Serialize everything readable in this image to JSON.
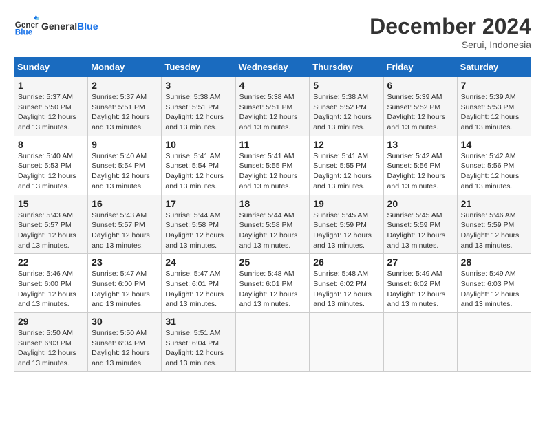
{
  "header": {
    "logo_text_general": "General",
    "logo_text_blue": "Blue",
    "month_title": "December 2024",
    "location": "Serui, Indonesia"
  },
  "days_of_week": [
    "Sunday",
    "Monday",
    "Tuesday",
    "Wednesday",
    "Thursday",
    "Friday",
    "Saturday"
  ],
  "weeks": [
    [
      {
        "day": "1",
        "sunrise": "5:37 AM",
        "sunset": "5:50 PM",
        "daylight": "12 hours and 13 minutes."
      },
      {
        "day": "2",
        "sunrise": "5:37 AM",
        "sunset": "5:51 PM",
        "daylight": "12 hours and 13 minutes."
      },
      {
        "day": "3",
        "sunrise": "5:38 AM",
        "sunset": "5:51 PM",
        "daylight": "12 hours and 13 minutes."
      },
      {
        "day": "4",
        "sunrise": "5:38 AM",
        "sunset": "5:51 PM",
        "daylight": "12 hours and 13 minutes."
      },
      {
        "day": "5",
        "sunrise": "5:38 AM",
        "sunset": "5:52 PM",
        "daylight": "12 hours and 13 minutes."
      },
      {
        "day": "6",
        "sunrise": "5:39 AM",
        "sunset": "5:52 PM",
        "daylight": "12 hours and 13 minutes."
      },
      {
        "day": "7",
        "sunrise": "5:39 AM",
        "sunset": "5:53 PM",
        "daylight": "12 hours and 13 minutes."
      }
    ],
    [
      {
        "day": "8",
        "sunrise": "5:40 AM",
        "sunset": "5:53 PM",
        "daylight": "12 hours and 13 minutes."
      },
      {
        "day": "9",
        "sunrise": "5:40 AM",
        "sunset": "5:54 PM",
        "daylight": "12 hours and 13 minutes."
      },
      {
        "day": "10",
        "sunrise": "5:41 AM",
        "sunset": "5:54 PM",
        "daylight": "12 hours and 13 minutes."
      },
      {
        "day": "11",
        "sunrise": "5:41 AM",
        "sunset": "5:55 PM",
        "daylight": "12 hours and 13 minutes."
      },
      {
        "day": "12",
        "sunrise": "5:41 AM",
        "sunset": "5:55 PM",
        "daylight": "12 hours and 13 minutes."
      },
      {
        "day": "13",
        "sunrise": "5:42 AM",
        "sunset": "5:56 PM",
        "daylight": "12 hours and 13 minutes."
      },
      {
        "day": "14",
        "sunrise": "5:42 AM",
        "sunset": "5:56 PM",
        "daylight": "12 hours and 13 minutes."
      }
    ],
    [
      {
        "day": "15",
        "sunrise": "5:43 AM",
        "sunset": "5:57 PM",
        "daylight": "12 hours and 13 minutes."
      },
      {
        "day": "16",
        "sunrise": "5:43 AM",
        "sunset": "5:57 PM",
        "daylight": "12 hours and 13 minutes."
      },
      {
        "day": "17",
        "sunrise": "5:44 AM",
        "sunset": "5:58 PM",
        "daylight": "12 hours and 13 minutes."
      },
      {
        "day": "18",
        "sunrise": "5:44 AM",
        "sunset": "5:58 PM",
        "daylight": "12 hours and 13 minutes."
      },
      {
        "day": "19",
        "sunrise": "5:45 AM",
        "sunset": "5:59 PM",
        "daylight": "12 hours and 13 minutes."
      },
      {
        "day": "20",
        "sunrise": "5:45 AM",
        "sunset": "5:59 PM",
        "daylight": "12 hours and 13 minutes."
      },
      {
        "day": "21",
        "sunrise": "5:46 AM",
        "sunset": "5:59 PM",
        "daylight": "12 hours and 13 minutes."
      }
    ],
    [
      {
        "day": "22",
        "sunrise": "5:46 AM",
        "sunset": "6:00 PM",
        "daylight": "12 hours and 13 minutes."
      },
      {
        "day": "23",
        "sunrise": "5:47 AM",
        "sunset": "6:00 PM",
        "daylight": "12 hours and 13 minutes."
      },
      {
        "day": "24",
        "sunrise": "5:47 AM",
        "sunset": "6:01 PM",
        "daylight": "12 hours and 13 minutes."
      },
      {
        "day": "25",
        "sunrise": "5:48 AM",
        "sunset": "6:01 PM",
        "daylight": "12 hours and 13 minutes."
      },
      {
        "day": "26",
        "sunrise": "5:48 AM",
        "sunset": "6:02 PM",
        "daylight": "12 hours and 13 minutes."
      },
      {
        "day": "27",
        "sunrise": "5:49 AM",
        "sunset": "6:02 PM",
        "daylight": "12 hours and 13 minutes."
      },
      {
        "day": "28",
        "sunrise": "5:49 AM",
        "sunset": "6:03 PM",
        "daylight": "12 hours and 13 minutes."
      }
    ],
    [
      {
        "day": "29",
        "sunrise": "5:50 AM",
        "sunset": "6:03 PM",
        "daylight": "12 hours and 13 minutes."
      },
      {
        "day": "30",
        "sunrise": "5:50 AM",
        "sunset": "6:04 PM",
        "daylight": "12 hours and 13 minutes."
      },
      {
        "day": "31",
        "sunrise": "5:51 AM",
        "sunset": "6:04 PM",
        "daylight": "12 hours and 13 minutes."
      },
      null,
      null,
      null,
      null
    ]
  ]
}
